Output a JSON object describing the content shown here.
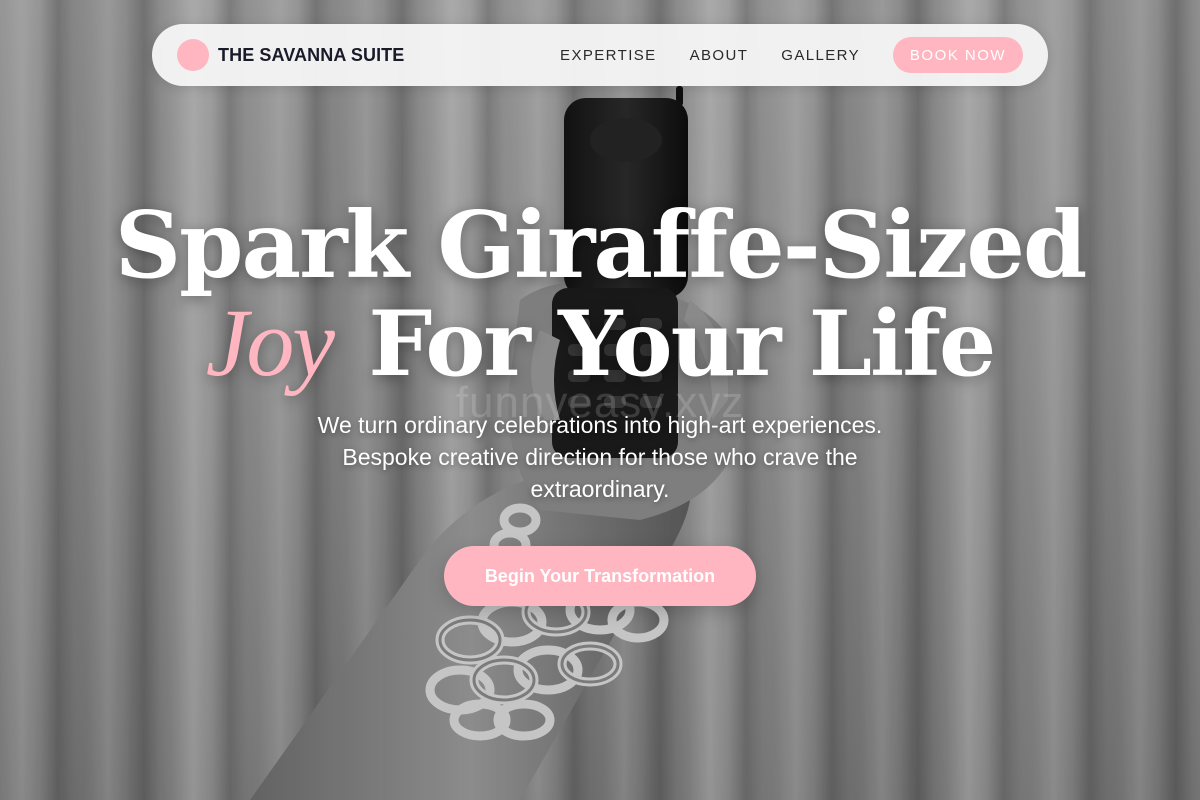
{
  "nav": {
    "brand_name": "THE SAVANNA SUITE",
    "brand_icon": "pink-circle-logo",
    "links": [
      "EXPERTISE",
      "ABOUT",
      "GALLERY"
    ],
    "cta_label": "BOOK NOW"
  },
  "hero": {
    "headline_line1": "Spark Giraffe-Sized",
    "headline_accent": "Joy",
    "headline_line2_rest": "For Your Life",
    "watermark": "funnyeasy.xyz",
    "subtitle": "We turn ordinary celebrations into high-art experiences. Bespoke creative direction for those who crave the extraordinary.",
    "cta_label": "Begin Your Transformation",
    "background_image": "black-and-white photo of a raised hand holding a flip phone, wearing chunky silver chain bracelets, in front of a pleated curtain"
  },
  "colors": {
    "accent": "#ffb6c1",
    "nav_bg": "#f5f5f5",
    "brand_text": "#1a1a2a",
    "headline_text": "#ffffff"
  }
}
